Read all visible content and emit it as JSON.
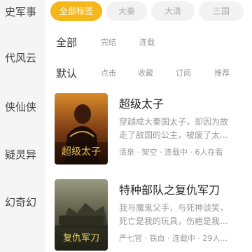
{
  "sidebar": {
    "items": [
      {
        "label": "史军事"
      },
      {
        "label": "代风云"
      },
      {
        "label": "侠仙侠"
      },
      {
        "label": "疑灵异"
      },
      {
        "label": "幻奇幻"
      }
    ]
  },
  "chips": [
    {
      "label": "全部标签",
      "active": true
    },
    {
      "label": "大秦",
      "active": false
    },
    {
      "label": "大清",
      "active": false
    },
    {
      "label": "三国",
      "active": false
    }
  ],
  "status_filters": [
    {
      "label": "全部",
      "active": true
    },
    {
      "label": "完结",
      "active": false
    },
    {
      "label": "连载",
      "active": false
    }
  ],
  "sort_filters": [
    {
      "label": "默认",
      "active": true
    },
    {
      "label": "点击",
      "active": false
    },
    {
      "label": "收藏",
      "active": false
    },
    {
      "label": "订阅",
      "active": false
    },
    {
      "label": "推荐",
      "active": false
    }
  ],
  "books": [
    {
      "title": "超级太子",
      "desc_line1": "穿越成大秦国太子，却因为故",
      "desc_line2": "走了敌国的公主，被废了太...",
      "meta": "清泉 · 架空 · 连载中 · 6人在看",
      "cover_text": "超级太子"
    },
    {
      "title": "特种部队之复仇军刀",
      "desc_line1": "我与魔鬼父手，与死神谈笑，",
      "desc_line2": "死亡是我的玩具，伤疤是我...",
      "meta": "严七官 · 铁血 · 连载中 · 29人...",
      "cover_text": "复仇军刀"
    }
  ],
  "colors": {
    "accent": "#f5b81c",
    "sidebar_bg": "#f5f5f5"
  }
}
